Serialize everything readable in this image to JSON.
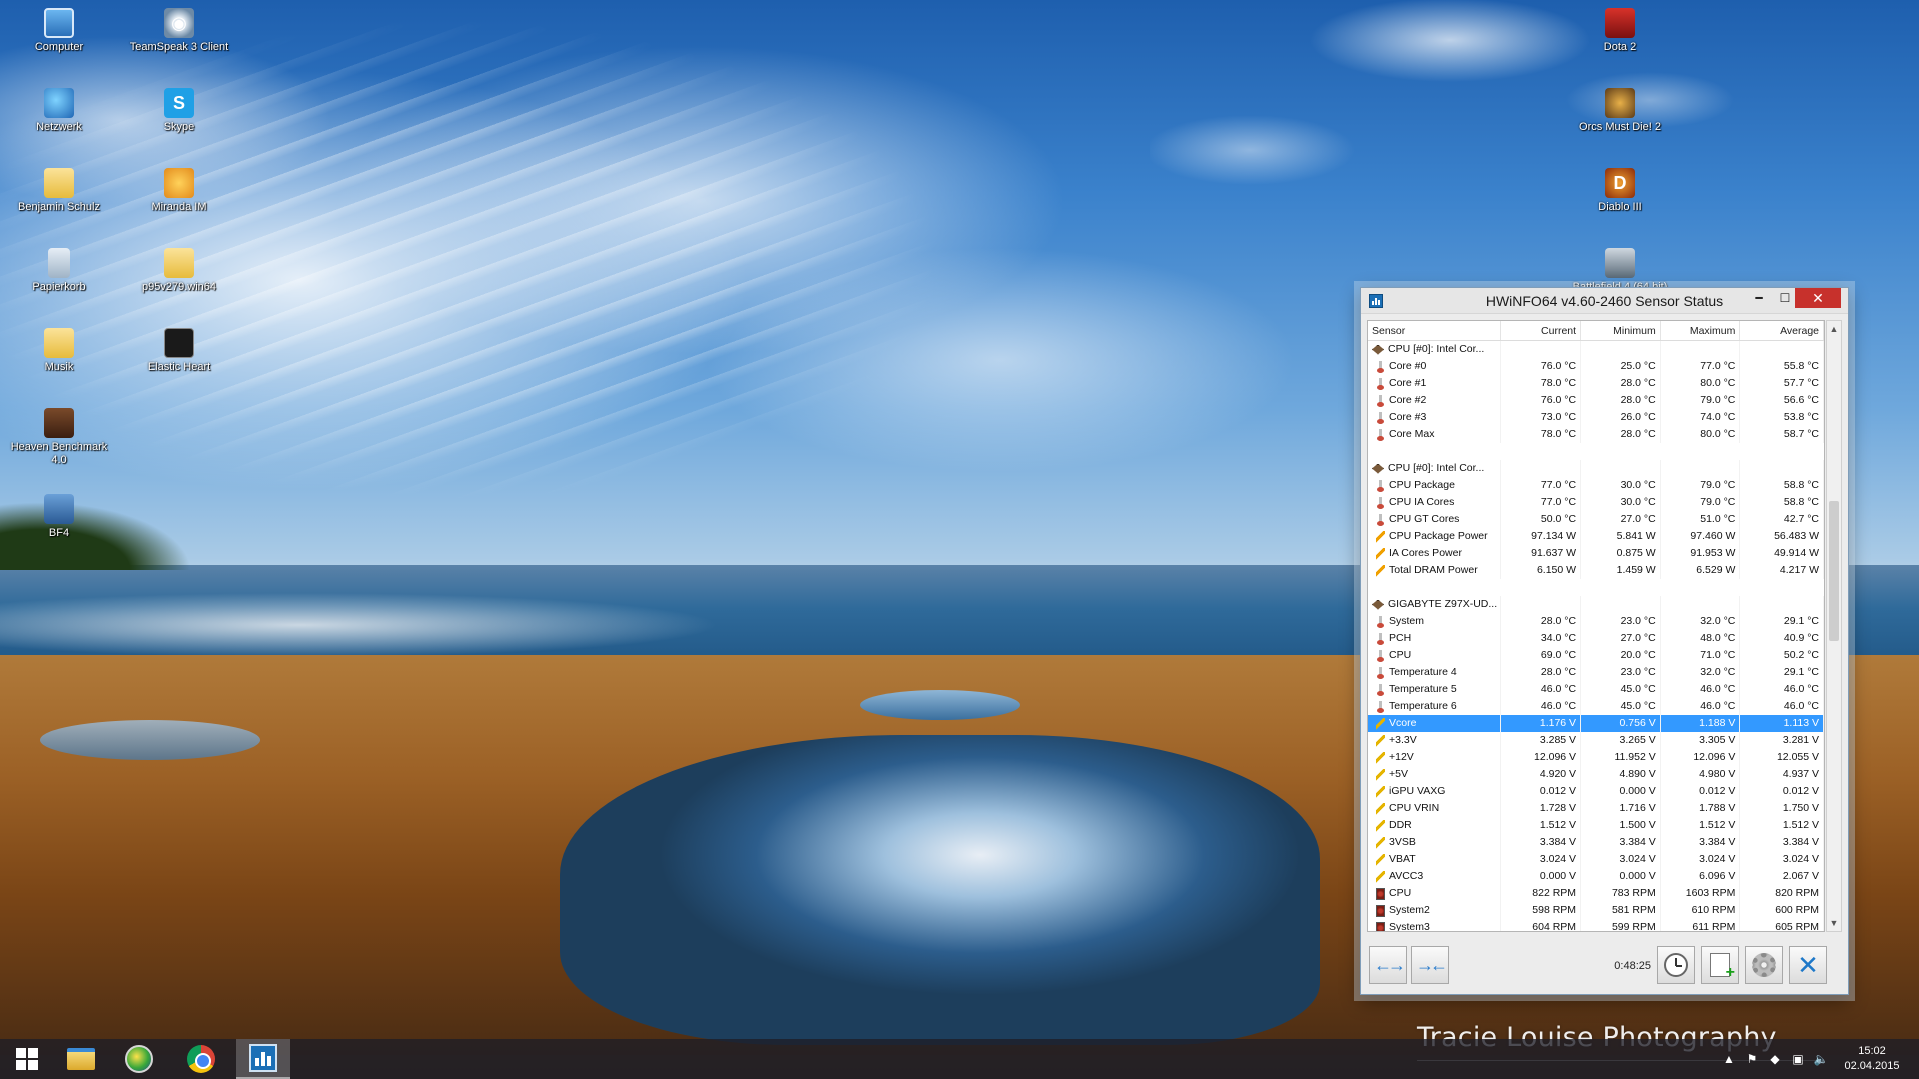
{
  "desktop": {
    "left_icons": [
      {
        "label": "Computer",
        "icon": "computer-icon"
      },
      {
        "label": "TeamSpeak 3 Client",
        "icon": "teamspeak-icon"
      },
      {
        "label": "Netzwerk",
        "icon": "network-icon"
      },
      {
        "label": "Skype",
        "icon": "skype-icon"
      },
      {
        "label": "Benjamin Schulz",
        "icon": "user-folder-icon"
      },
      {
        "label": "Miranda IM",
        "icon": "miranda-icon"
      },
      {
        "label": "Papierkorb",
        "icon": "recycle-bin-icon"
      },
      {
        "label": "p95v279.win64",
        "icon": "folder-icon"
      },
      {
        "label": "Musik",
        "icon": "folder-icon"
      },
      {
        "label": "Elastic Heart",
        "icon": "media-file-icon"
      },
      {
        "label": "Heaven Benchmark 4.0",
        "icon": "heaven-benchmark-icon"
      },
      {
        "label": "BF4",
        "icon": "bf4-icon"
      }
    ],
    "right_icons": [
      {
        "label": "Dota 2",
        "icon": "dota-icon"
      },
      {
        "label": "Orcs Must Die! 2",
        "icon": "orcs-icon"
      },
      {
        "label": "Diablo III",
        "icon": "diablo-icon"
      },
      {
        "label": "Battlefield 4 (64 bit)",
        "icon": "battlefield-icon"
      }
    ],
    "watermark": "Tracie Louise Photography"
  },
  "hwinfo": {
    "title": "HWiNFO64 v4.60-2460 Sensor Status",
    "columns": {
      "sensor": "Sensor",
      "current": "Current",
      "minimum": "Minimum",
      "maximum": "Maximum",
      "average": "Average"
    },
    "rows": [
      {
        "type": "group",
        "name": "CPU [#0]: Intel Cor...",
        "icon": "chip"
      },
      {
        "type": "row",
        "name": "Core #0",
        "icon": "therm",
        "cur": "76.0 °C",
        "min": "25.0 °C",
        "max": "77.0 °C",
        "avg": "55.8 °C"
      },
      {
        "type": "row",
        "name": "Core #1",
        "icon": "therm",
        "cur": "78.0 °C",
        "min": "28.0 °C",
        "max": "80.0 °C",
        "avg": "57.7 °C"
      },
      {
        "type": "row",
        "name": "Core #2",
        "icon": "therm",
        "cur": "76.0 °C",
        "min": "28.0 °C",
        "max": "79.0 °C",
        "avg": "56.6 °C"
      },
      {
        "type": "row",
        "name": "Core #3",
        "icon": "therm",
        "cur": "73.0 °C",
        "min": "26.0 °C",
        "max": "74.0 °C",
        "avg": "53.8 °C"
      },
      {
        "type": "row",
        "name": "Core Max",
        "icon": "therm",
        "cur": "78.0 °C",
        "min": "28.0 °C",
        "max": "80.0 °C",
        "avg": "58.7 °C"
      },
      {
        "type": "spacer"
      },
      {
        "type": "group",
        "name": "CPU [#0]: Intel Cor...",
        "icon": "chip"
      },
      {
        "type": "row",
        "name": "CPU Package",
        "icon": "therm",
        "cur": "77.0 °C",
        "min": "30.0 °C",
        "max": "79.0 °C",
        "avg": "58.8 °C"
      },
      {
        "type": "row",
        "name": "CPU IA Cores",
        "icon": "therm",
        "cur": "77.0 °C",
        "min": "30.0 °C",
        "max": "79.0 °C",
        "avg": "58.8 °C"
      },
      {
        "type": "row",
        "name": "CPU GT Cores",
        "icon": "therm",
        "cur": "50.0 °C",
        "min": "27.0 °C",
        "max": "51.0 °C",
        "avg": "42.7 °C"
      },
      {
        "type": "row",
        "name": "CPU Package Power",
        "icon": "power",
        "cur": "97.134 W",
        "min": "5.841 W",
        "max": "97.460 W",
        "avg": "56.483 W"
      },
      {
        "type": "row",
        "name": "IA Cores Power",
        "icon": "power",
        "cur": "91.637 W",
        "min": "0.875 W",
        "max": "91.953 W",
        "avg": "49.914 W"
      },
      {
        "type": "row",
        "name": "Total DRAM Power",
        "icon": "power",
        "cur": "6.150 W",
        "min": "1.459 W",
        "max": "6.529 W",
        "avg": "4.217 W"
      },
      {
        "type": "spacer"
      },
      {
        "type": "group",
        "name": "GIGABYTE Z97X-UD...",
        "icon": "chip"
      },
      {
        "type": "row",
        "name": "System",
        "icon": "therm",
        "cur": "28.0 °C",
        "min": "23.0 °C",
        "max": "32.0 °C",
        "avg": "29.1 °C"
      },
      {
        "type": "row",
        "name": "PCH",
        "icon": "therm",
        "cur": "34.0 °C",
        "min": "27.0 °C",
        "max": "48.0 °C",
        "avg": "40.9 °C"
      },
      {
        "type": "row",
        "name": "CPU",
        "icon": "therm",
        "cur": "69.0 °C",
        "min": "20.0 °C",
        "max": "71.0 °C",
        "avg": "50.2 °C"
      },
      {
        "type": "row",
        "name": "Temperature 4",
        "icon": "therm",
        "cur": "28.0 °C",
        "min": "23.0 °C",
        "max": "32.0 °C",
        "avg": "29.1 °C"
      },
      {
        "type": "row",
        "name": "Temperature 5",
        "icon": "therm",
        "cur": "46.0 °C",
        "min": "45.0 °C",
        "max": "46.0 °C",
        "avg": "46.0 °C"
      },
      {
        "type": "row",
        "name": "Temperature 6",
        "icon": "therm",
        "cur": "46.0 °C",
        "min": "45.0 °C",
        "max": "46.0 °C",
        "avg": "46.0 °C"
      },
      {
        "type": "row",
        "name": "Vcore",
        "icon": "volt",
        "cur": "1.176 V",
        "min": "0.756 V",
        "max": "1.188 V",
        "avg": "1.113 V",
        "selected": true
      },
      {
        "type": "row",
        "name": "+3.3V",
        "icon": "volt",
        "cur": "3.285 V",
        "min": "3.265 V",
        "max": "3.305 V",
        "avg": "3.281 V"
      },
      {
        "type": "row",
        "name": "+12V",
        "icon": "volt",
        "cur": "12.096 V",
        "min": "11.952 V",
        "max": "12.096 V",
        "avg": "12.055 V"
      },
      {
        "type": "row",
        "name": "+5V",
        "icon": "volt",
        "cur": "4.920 V",
        "min": "4.890 V",
        "max": "4.980 V",
        "avg": "4.937 V"
      },
      {
        "type": "row",
        "name": "iGPU VAXG",
        "icon": "volt",
        "cur": "0.012 V",
        "min": "0.000 V",
        "max": "0.012 V",
        "avg": "0.012 V"
      },
      {
        "type": "row",
        "name": "CPU VRIN",
        "icon": "volt",
        "cur": "1.728 V",
        "min": "1.716 V",
        "max": "1.788 V",
        "avg": "1.750 V"
      },
      {
        "type": "row",
        "name": "DDR",
        "icon": "volt",
        "cur": "1.512 V",
        "min": "1.500 V",
        "max": "1.512 V",
        "avg": "1.512 V"
      },
      {
        "type": "row",
        "name": "3VSB",
        "icon": "volt",
        "cur": "3.384 V",
        "min": "3.384 V",
        "max": "3.384 V",
        "avg": "3.384 V"
      },
      {
        "type": "row",
        "name": "VBAT",
        "icon": "volt",
        "cur": "3.024 V",
        "min": "3.024 V",
        "max": "3.024 V",
        "avg": "3.024 V"
      },
      {
        "type": "row",
        "name": "AVCC3",
        "icon": "volt",
        "cur": "0.000 V",
        "min": "0.000 V",
        "max": "6.096 V",
        "avg": "2.067 V"
      },
      {
        "type": "row",
        "name": "CPU",
        "icon": "fan",
        "cur": "822 RPM",
        "min": "783 RPM",
        "max": "1603 RPM",
        "avg": "820 RPM"
      },
      {
        "type": "row",
        "name": "System2",
        "icon": "fan",
        "cur": "598 RPM",
        "min": "581 RPM",
        "max": "610 RPM",
        "avg": "600 RPM"
      },
      {
        "type": "row",
        "name": "System3",
        "icon": "fan",
        "cur": "604 RPM",
        "min": "599 RPM",
        "max": "611 RPM",
        "avg": "605 RPM"
      }
    ],
    "footer": {
      "timer": "0:48:25"
    }
  },
  "taskbar": {
    "apps": [
      "start-button",
      "file-explorer",
      "globe-app",
      "chrome",
      "hwinfo"
    ],
    "time": "15:02",
    "date": "02.04.2015"
  },
  "colors": {
    "selection": "#3399ff",
    "close_button": "#c7312c",
    "taskbar": "#1e1e26"
  }
}
